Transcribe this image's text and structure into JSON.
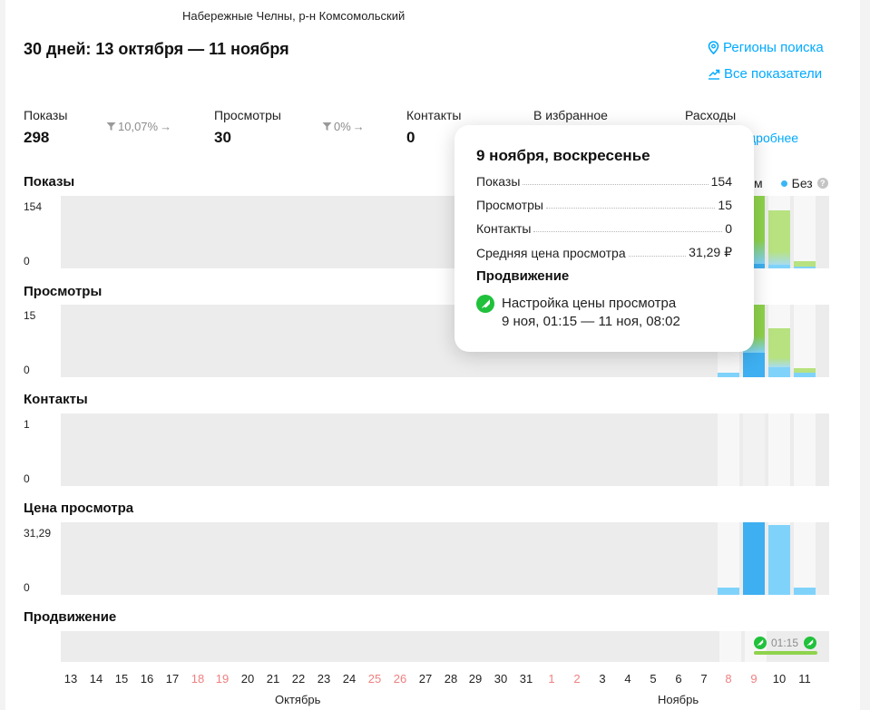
{
  "header": {
    "region": "Набережные Челны, р-н Комсомольский",
    "period": "30 дней: 13 октября — 11 ноября",
    "links": {
      "regions": "Регионы поиска",
      "all_metrics": "Все показатели",
      "details": "дробнее"
    }
  },
  "stats": [
    {
      "label": "Показы",
      "value": "298",
      "delta": "10,07%"
    },
    {
      "label": "Просмотры",
      "value": "30",
      "delta": "0%"
    },
    {
      "label": "Контакты",
      "value": "0"
    },
    {
      "label": "В избранное"
    },
    {
      "label": "Расходы"
    }
  ],
  "legend": {
    "partial": "м",
    "without": "Без"
  },
  "colors": {
    "accent": "#00aaff",
    "blue_bar": "#7fd3fb",
    "blue_bar_dark": "#3eaff0",
    "green_bar": "#8ed34c",
    "weekend": "#f08080",
    "plot_bg": "#ececec",
    "promo_green": "#20c13b"
  },
  "sections": [
    {
      "title": "Показы",
      "ymax": "154",
      "ymin": "0"
    },
    {
      "title": "Просмотры",
      "ymax": "15",
      "ymin": "0"
    },
    {
      "title": "Контакты",
      "ymax": "1",
      "ymin": "0"
    },
    {
      "title": "Цена просмотра",
      "ymax": "31,29",
      "ymin": "0"
    },
    {
      "title": "Продвижение"
    }
  ],
  "days": [
    "13",
    "14",
    "15",
    "16",
    "17",
    "18",
    "19",
    "20",
    "21",
    "22",
    "23",
    "24",
    "25",
    "26",
    "27",
    "28",
    "29",
    "30",
    "31",
    "1",
    "2",
    "3",
    "4",
    "5",
    "6",
    "7",
    "8",
    "9",
    "10",
    "11"
  ],
  "weekend_days": [
    "18",
    "19",
    "25",
    "26",
    "1",
    "2",
    "8",
    "9"
  ],
  "months": {
    "october": "Октябрь",
    "november": "Ноябрь"
  },
  "chart_data": [
    {
      "type": "bar",
      "title": "Показы",
      "ylim": [
        0,
        154
      ],
      "categories": [
        "8",
        "9",
        "10",
        "11"
      ],
      "series": [
        {
          "name": "Без",
          "values": [
            0,
            10,
            8,
            2
          ]
        },
        {
          "values": [
            0,
            144,
            116,
            11
          ]
        }
      ]
    },
    {
      "type": "bar",
      "title": "Просмотры",
      "ylim": [
        0,
        15
      ],
      "categories": [
        "8",
        "9",
        "10",
        "11"
      ],
      "series": [
        {
          "name": "Без",
          "values": [
            1,
            5,
            2,
            1
          ]
        },
        {
          "values": [
            0,
            10,
            8,
            1
          ]
        }
      ]
    },
    {
      "type": "bar",
      "title": "Контакты",
      "ylim": [
        0,
        1
      ],
      "categories": [
        "8",
        "9",
        "10",
        "11"
      ],
      "series": [
        {
          "values": [
            0,
            0,
            0,
            0
          ]
        }
      ]
    },
    {
      "type": "bar",
      "title": "Цена просмотра",
      "ylim": [
        0,
        31.29
      ],
      "categories": [
        "8",
        "9",
        "10",
        "11"
      ],
      "series": [
        {
          "values": [
            3.1,
            31.29,
            30.1,
            3.0
          ]
        }
      ]
    }
  ],
  "promotion": {
    "time_label": "01:15"
  },
  "tooltip": {
    "title": "9 ноября, воскресенье",
    "rows": [
      {
        "label": "Показы",
        "value": "154"
      },
      {
        "label": "Просмотры",
        "value": "15"
      },
      {
        "label": "Контакты",
        "value": "0"
      },
      {
        "label": "Средняя цена просмотра",
        "value": "31,29 ₽"
      }
    ],
    "promo_title": "Продвижение",
    "promo_name": "Настройка цены просмотра",
    "promo_time": "9 ноя, 01:15 — 11 ноя, 08:02"
  }
}
